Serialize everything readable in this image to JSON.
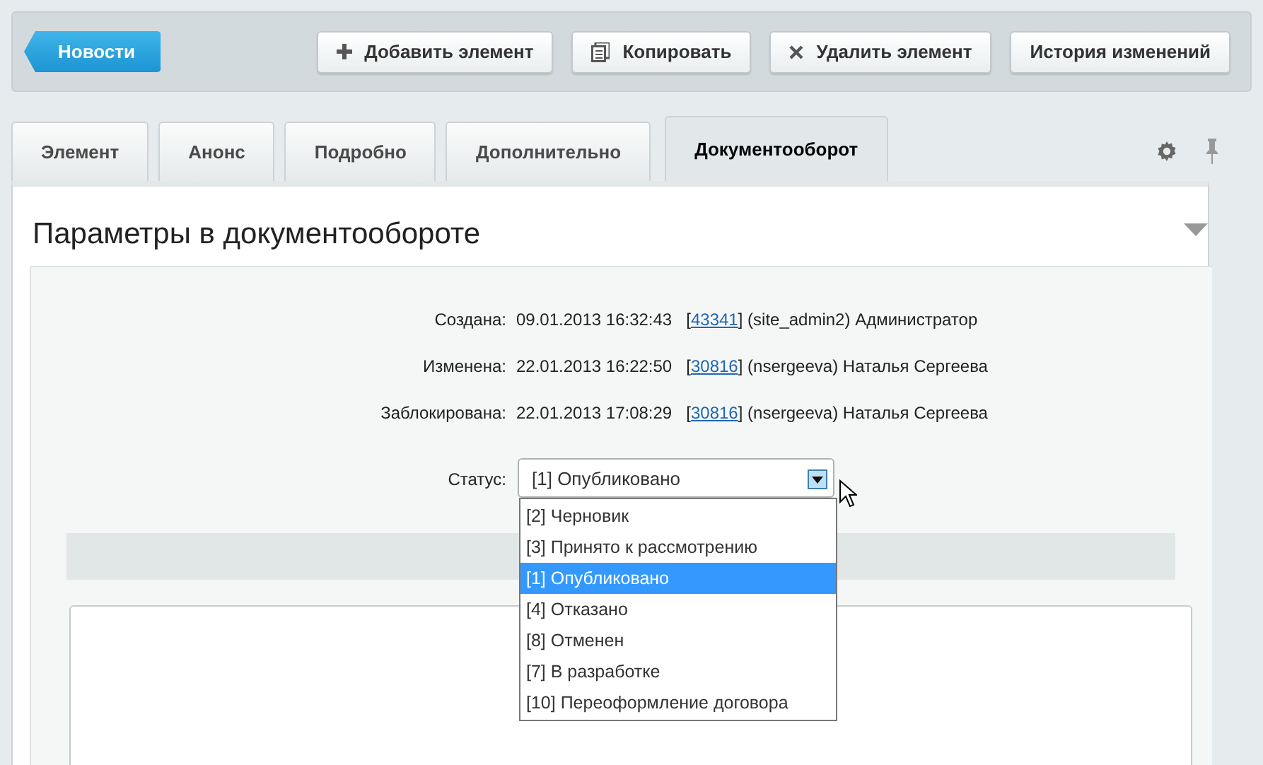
{
  "back_button": {
    "label": "Новости"
  },
  "toolbar": [
    {
      "label": "Добавить элемент"
    },
    {
      "label": "Копировать"
    },
    {
      "label": "Удалить элемент"
    },
    {
      "label": "История изменений"
    }
  ],
  "tabs": [
    {
      "label": "Элемент",
      "selected": false
    },
    {
      "label": "Анонс",
      "selected": false
    },
    {
      "label": "Подробно",
      "selected": false
    },
    {
      "label": "Дополнительно",
      "selected": false
    },
    {
      "label": "Документооборот",
      "selected": true
    }
  ],
  "section": {
    "title": "Параметры в документообороте",
    "expanded": true
  },
  "info_rows": [
    {
      "label": "Создана:",
      "date": "09.01.2013 16:32:43",
      "user_id": "[43341]",
      "user": "(site_admin2) Администратор"
    },
    {
      "label": "Изменена:",
      "date": "22.01.2013 16:22:50",
      "user_id": "[30816]",
      "user": "(nsergeeva) Наталья Сергеева"
    },
    {
      "label": "Заблокирована:",
      "date": "22.01.2013 17:08:29",
      "user_id": "[30816]",
      "user": "(nsergeeva) Наталья Сергеева"
    }
  ],
  "status": {
    "label": "Статус:",
    "value": "[1] Опубликовано",
    "expanded": true,
    "options": [
      {
        "label": "[2] Черновик",
        "selected": false
      },
      {
        "label": "[3] Принято к рассмотрению",
        "selected": false
      },
      {
        "label": "[1] Опубликовано",
        "selected": true
      },
      {
        "label": "[4] Отказано",
        "selected": false
      },
      {
        "label": "[8] Отменен",
        "selected": false
      },
      {
        "label": "[7] В разработке",
        "selected": false
      },
      {
        "label": "[10] Переоформление договора",
        "selected": false
      }
    ]
  }
}
